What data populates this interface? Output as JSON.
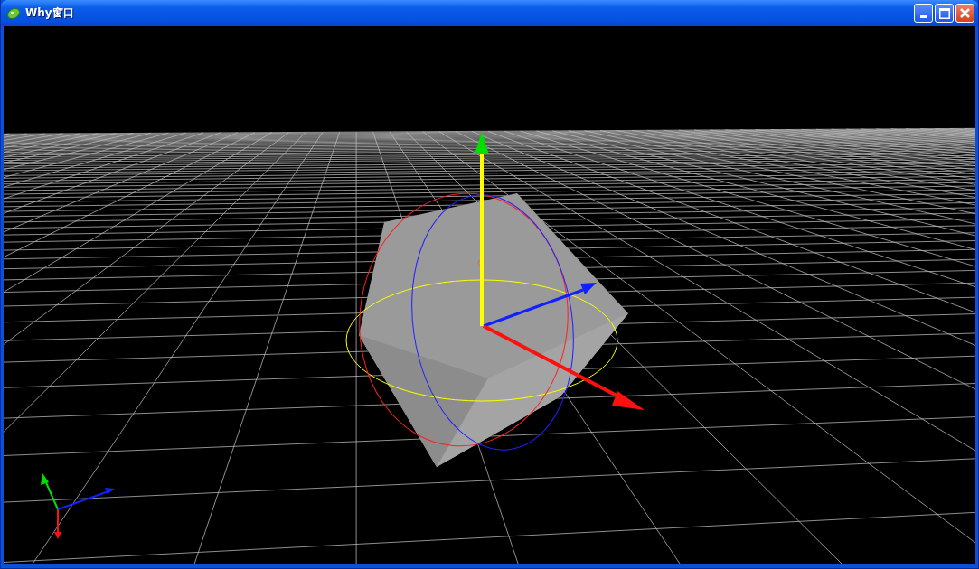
{
  "window": {
    "title": "Why窗口"
  }
}
